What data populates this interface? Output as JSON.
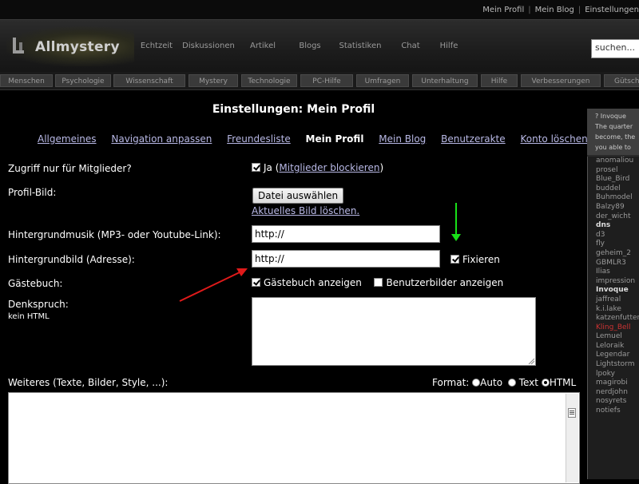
{
  "topbar": {
    "links": [
      "Mein Profil",
      "Mein Blog",
      "Einstellungen"
    ]
  },
  "header": {
    "logo_text": "Allmystery",
    "nav": [
      "Echtzeit",
      "Diskussionen",
      "Artikel",
      "Blogs",
      "Statistiken",
      "Chat",
      "Hilfe"
    ],
    "search_value": "suchen..."
  },
  "categories": [
    "Menschen",
    "Psychologie",
    "Wissenschaft",
    "Mystery",
    "Technologie",
    "PC-Hilfe",
    "Umfragen",
    "Unterhaltung",
    "Hilfe",
    "Verbesserungen",
    "Gütschi"
  ],
  "page": {
    "title": "Einstellungen: Mein Profil",
    "tabs": [
      "Allgemeines",
      "Navigation anpassen",
      "Freundesliste",
      "Mein Profil",
      "Mein Blog",
      "Benutzerakte",
      "Konto löschen"
    ],
    "active_tab": "Mein Profil"
  },
  "form": {
    "members_only": {
      "label": "Zugriff nur für Mitglieder?",
      "option": "Ja",
      "open_paren": "(",
      "link": "Mitglieder blockieren",
      "close_paren": ")",
      "checked": true
    },
    "profile_image": {
      "label": "Profil-Bild:",
      "button": "Datei auswählen",
      "delete_link": "Aktuelles Bild löschen."
    },
    "music": {
      "label": "Hintergrundmusik (MP3- oder Youtube-Link):",
      "value": "http://"
    },
    "background": {
      "label": "Hintergrundbild (Adresse):",
      "value": "http://",
      "fix_label": "Fixieren",
      "fix_checked": true
    },
    "guestbook": {
      "label": "Gästebuch:",
      "show_label": "Gästebuch anzeigen",
      "show_checked": true,
      "images_label": "Benutzerbilder anzeigen",
      "images_checked": false
    },
    "motto": {
      "label": "Denkspruch:",
      "note": "kein HTML",
      "value": ""
    },
    "more": {
      "label": "Weiteres (Texte, Bilder, Style, ...):",
      "format_label": "Format:",
      "options": [
        "Auto",
        "Text",
        "HTML"
      ],
      "selected": "HTML",
      "value": ""
    }
  },
  "sidebar": {
    "header_lines": [
      "? Invoque",
      "The quarter",
      "become, the",
      "you able to"
    ],
    "users": [
      "anomaliou",
      "prosel",
      "Blue_Bird",
      "buddel",
      "Buhmodel",
      "Balzy89",
      "der_wicht",
      "dns",
      "d3",
      "fly",
      "geheim_2",
      "GBMLR3",
      "Ilias",
      "impression",
      "Invoque",
      "jaffreal",
      "k.i.lake",
      "katzenfutter",
      "Kling_Bell",
      "Lemuel",
      "Leloraik",
      "Legendar",
      "Lightstorm",
      "lpoky",
      "magirobi",
      "nerdjohn",
      "nosyrets",
      "notiefs"
    ],
    "bold_users": [
      "dns",
      "Invoque"
    ],
    "red_users": [
      "Kling_Bell"
    ],
    "colors": {
      "bg": "#2a2a2a",
      "header": "#3f3f3f",
      "red": "#cc3333"
    }
  },
  "colors": {
    "link": "#b9b9e6",
    "arrow_red": "#e01a1a",
    "arrow_green": "#18e018"
  }
}
